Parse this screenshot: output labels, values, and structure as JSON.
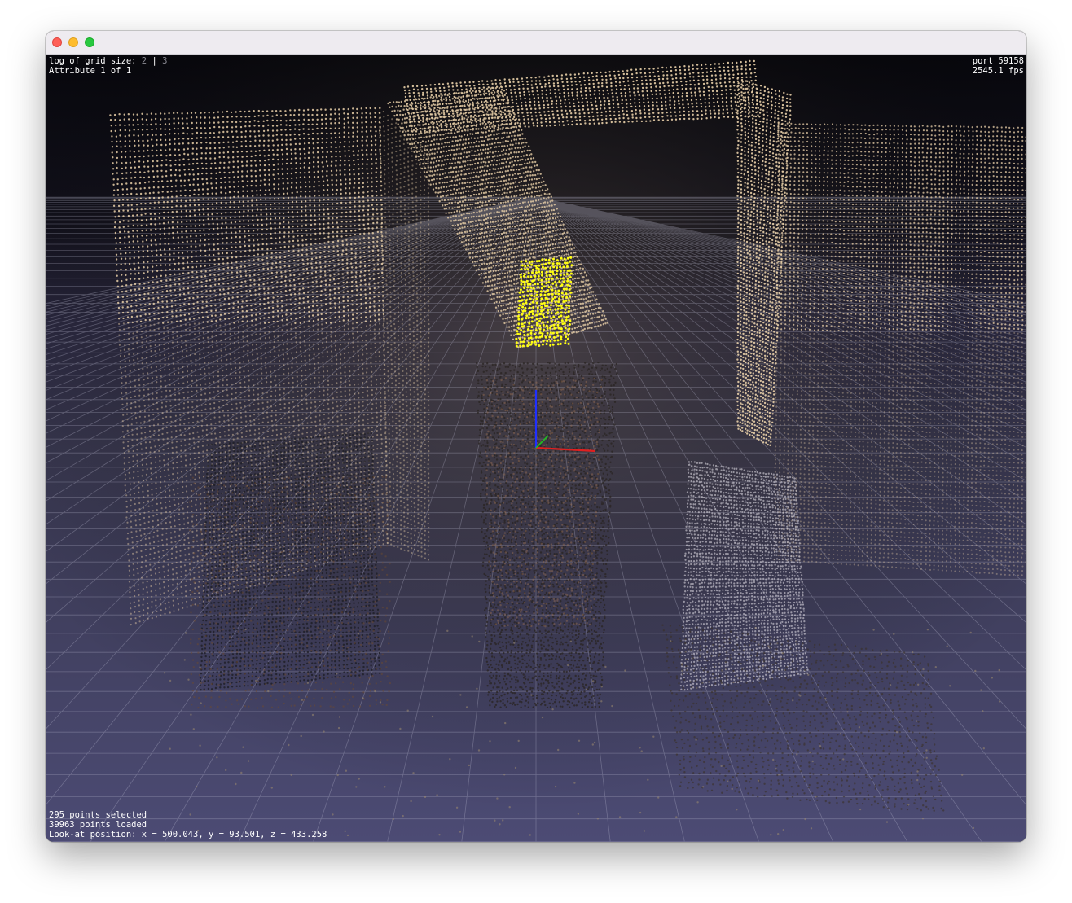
{
  "window": {
    "controls": {
      "close": "close-button",
      "minimize": "minimize-button",
      "zoom": "zoom-button"
    }
  },
  "overlay": {
    "grid_size_label": "log of grid size:",
    "grid_size_values": [
      "2",
      "3"
    ],
    "grid_size_separator": "|",
    "attribute_label": "Attribute 1 of 1",
    "port_label": "port 59158",
    "fps_label": "2545.1 fps",
    "points_selected": "295 points selected",
    "points_loaded": "39963 points loaded",
    "lookat_position": "Look-at position: x = 500.043, y = 93.501, z = 433.258"
  },
  "scene": {
    "background_top": "#08080e",
    "background_horizon": "#2a2840",
    "floor_color": "#4a4a72",
    "grid_color": "#c0c0d8",
    "point_color": "#e8cfa8",
    "selection_color": "#ffff10",
    "axis_x_color": "#e02020",
    "axis_y_color": "#20c020",
    "axis_z_color": "#2030ff"
  }
}
